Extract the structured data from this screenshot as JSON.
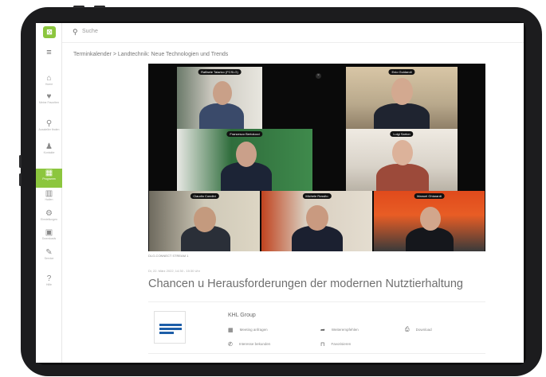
{
  "search": {
    "placeholder": "Suche"
  },
  "breadcrumb": {
    "parent": "Terminkalender",
    "separator": ">",
    "current": "Landtechnik: Neue Technologien und Trends"
  },
  "sidebar": {
    "items": [
      {
        "icon": "home-icon",
        "glyph": "⌂",
        "label": "Home"
      },
      {
        "icon": "heart-icon",
        "glyph": "♥",
        "label": "Meine Favoriten"
      },
      {
        "icon": "location-icon",
        "glyph": "⚲",
        "label": "Aussteller finden"
      },
      {
        "icon": "person-icon",
        "glyph": "♟",
        "label": "Kontakte"
      },
      {
        "icon": "calendar-icon",
        "glyph": "▦",
        "label": "Programm"
      },
      {
        "icon": "building-icon",
        "glyph": "▥",
        "label": "Hallen"
      },
      {
        "icon": "gear-icon",
        "glyph": "⚙",
        "label": "Einstellungen"
      },
      {
        "icon": "box-icon",
        "glyph": "▣",
        "label": "Downloads"
      },
      {
        "icon": "wrench-icon",
        "glyph": "✎",
        "label": "Service"
      },
      {
        "icon": "help-icon",
        "glyph": "?",
        "label": "Hilfe"
      }
    ]
  },
  "video": {
    "participants": [
      "Raffaele Talarico (FCSLG)",
      "Enio Guidaroli",
      "Francesco Bertolucci",
      "Luigi Sarton",
      "Claudio Condini",
      "Michele Rossito",
      "Manuel Ghiarardi"
    ],
    "close_glyph": "×"
  },
  "event": {
    "stream_label": "DLG-CONNECT STREAM 1",
    "date": "Di, 22. März 2022, 14:30 - 15:30 Uhr",
    "title": "Chancen u Herausforderungen der modernen Nutztierhaltung"
  },
  "organizer": {
    "name": "KHL Group",
    "actions": [
      {
        "icon": "calendar-icon",
        "glyph": "▦",
        "label": "Meeting anfragen"
      },
      {
        "icon": "share-icon",
        "glyph": "➦",
        "label": "Weiterempfehlen"
      },
      {
        "icon": "download-icon",
        "glyph": "⎙",
        "label": "Download"
      },
      {
        "icon": "phone-icon",
        "glyph": "✆",
        "label": "Interesse bekunden"
      },
      {
        "icon": "bookmark-icon",
        "glyph": "⊓",
        "label": "Favorisieren"
      }
    ]
  },
  "colors": {
    "accent": "#8cc63e",
    "frame": "#1c1c1e",
    "video_bg": "#0a0a0a"
  }
}
